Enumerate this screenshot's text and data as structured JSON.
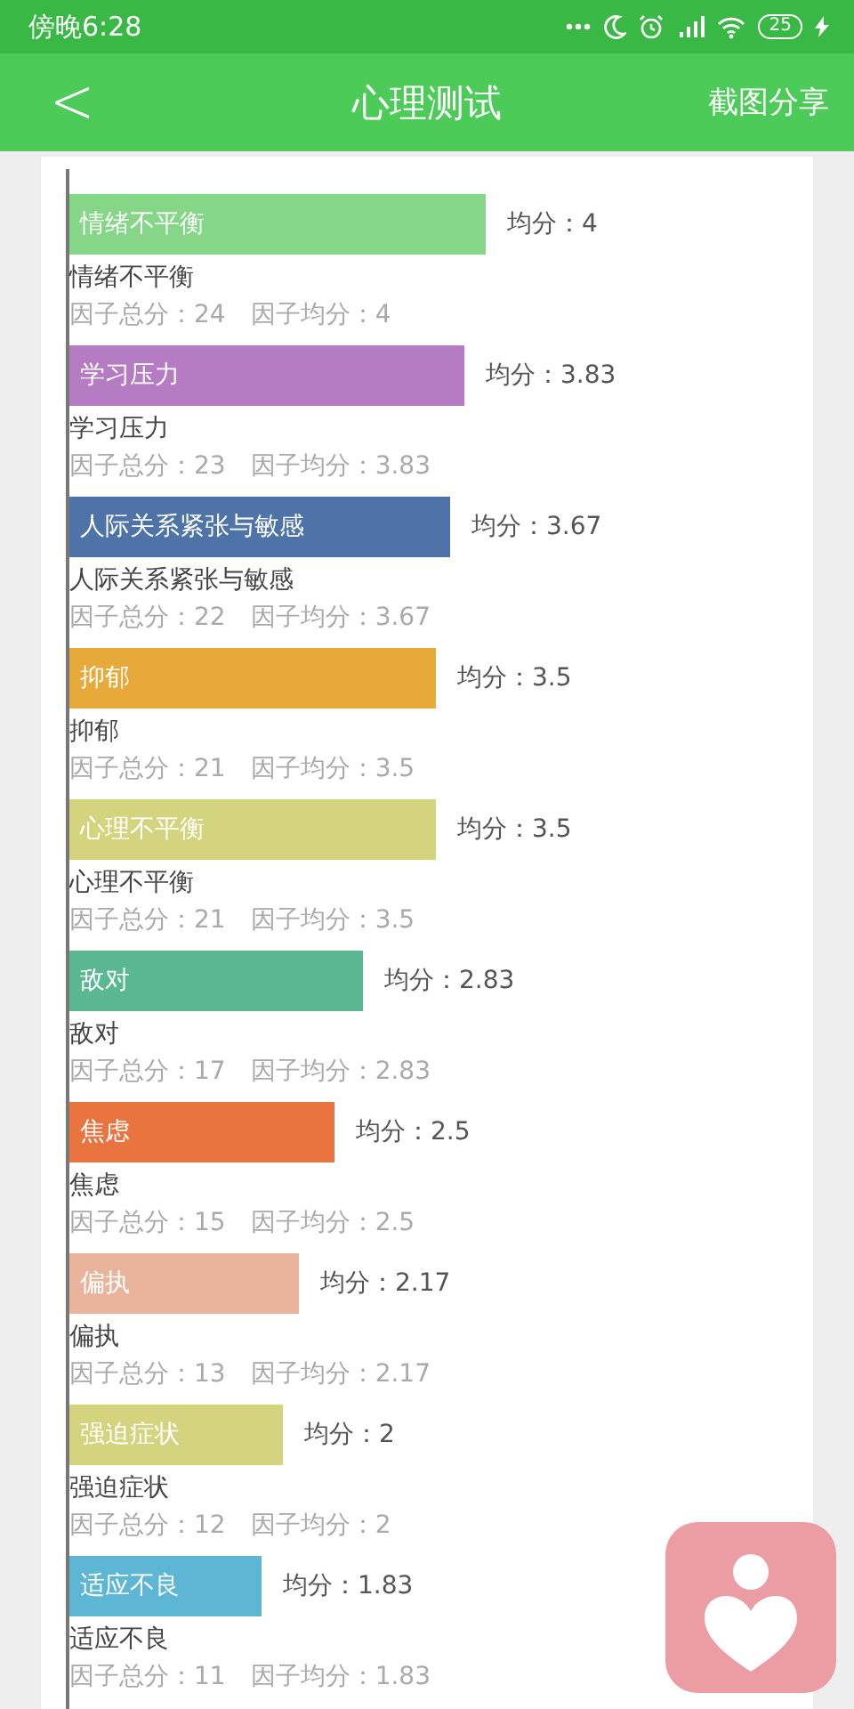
{
  "status_bar": {
    "time": "傍晚6:28",
    "battery": "25"
  },
  "header": {
    "back": "<",
    "title": "心理测试",
    "action": "截图分享"
  },
  "factors": [
    {
      "bar_label": "情绪不平衡",
      "average": "均分：4",
      "name": "情绪不平衡",
      "stats": "因子总分：24　因子均分：4",
      "color": "#85d687"
    },
    {
      "bar_label": "学习压力",
      "average": "均分：3.83",
      "name": "学习压力",
      "stats": "因子总分：23　因子均分：3.83",
      "color": "#b67cc3"
    },
    {
      "bar_label": "人际关系紧张与敏感",
      "average": "均分：3.67",
      "name": "人际关系紧张与敏感",
      "stats": "因子总分：22　因子均分：3.67",
      "color": "#4d73a9"
    },
    {
      "bar_label": "抑郁",
      "average": "均分：3.5",
      "name": "抑郁",
      "stats": "因子总分：21　因子均分：3.5",
      "color": "#e7a93a"
    },
    {
      "bar_label": "心理不平衡",
      "average": "均分：3.5",
      "name": "心理不平衡",
      "stats": "因子总分：21　因子均分：3.5",
      "color": "#d4d47f"
    },
    {
      "bar_label": "敌对",
      "average": "均分：2.83",
      "name": "敌对",
      "stats": "因子总分：17　因子均分：2.83",
      "color": "#59b792"
    },
    {
      "bar_label": "焦虑",
      "average": "均分：2.5",
      "name": "焦虑",
      "stats": "因子总分：15　因子均分：2.5",
      "color": "#ea743f"
    },
    {
      "bar_label": "偏执",
      "average": "均分：2.17",
      "name": "偏执",
      "stats": "因子总分：13　因子均分：2.17",
      "color": "#e9b49b"
    },
    {
      "bar_label": "强迫症状",
      "average": "均分：2",
      "name": "强迫症状",
      "stats": "因子总分：12　因子均分：2",
      "color": "#d4d47f"
    },
    {
      "bar_label": "适应不良",
      "average": "均分：1.83",
      "name": "适应不良",
      "stats": "因子总分：11　因子均分：1.83",
      "color": "#5db6d3"
    }
  ]
}
